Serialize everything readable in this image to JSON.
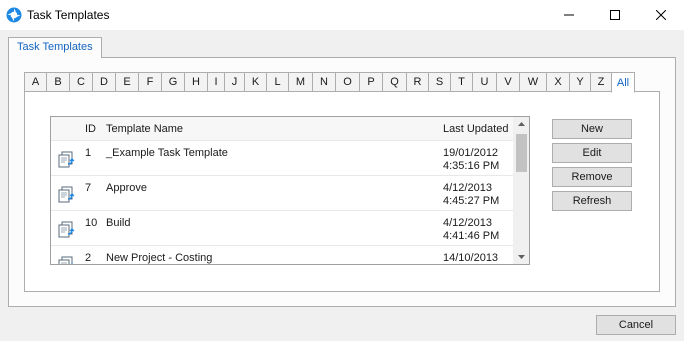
{
  "window": {
    "title": "Task Templates",
    "icon": "app-swirl-icon",
    "controls": [
      "minimize-icon",
      "maximize-icon",
      "close-icon"
    ]
  },
  "outer_tab": {
    "label": "Task Templates"
  },
  "letter_tabs": [
    "A",
    "B",
    "C",
    "D",
    "E",
    "F",
    "G",
    "H",
    "I",
    "J",
    "K",
    "L",
    "M",
    "N",
    "O",
    "P",
    "Q",
    "R",
    "S",
    "T",
    "U",
    "V",
    "W",
    "X",
    "Y",
    "Z",
    "All"
  ],
  "selected_letter": "All",
  "grid": {
    "columns": {
      "id": "ID",
      "name": "Template Name",
      "updated": "Last Updated"
    },
    "rows": [
      {
        "id": "1",
        "name": "_Example Task Template",
        "date": "19/01/2012",
        "time": "4:35:16 PM"
      },
      {
        "id": "7",
        "name": "Approve",
        "date": "4/12/2013",
        "time": "4:45:27 PM"
      },
      {
        "id": "10",
        "name": "Build",
        "date": "4/12/2013",
        "time": "4:41:46 PM"
      },
      {
        "id": "2",
        "name": "New Project - Costing",
        "date": "14/10/2013",
        "time": ""
      }
    ],
    "row_icon": "task-template-icon"
  },
  "buttons": {
    "new": "New",
    "edit": "Edit",
    "remove": "Remove",
    "refresh": "Refresh",
    "cancel": "Cancel"
  },
  "colors": {
    "accent": "#1565c0",
    "brand_icon": "#1e88e5"
  }
}
